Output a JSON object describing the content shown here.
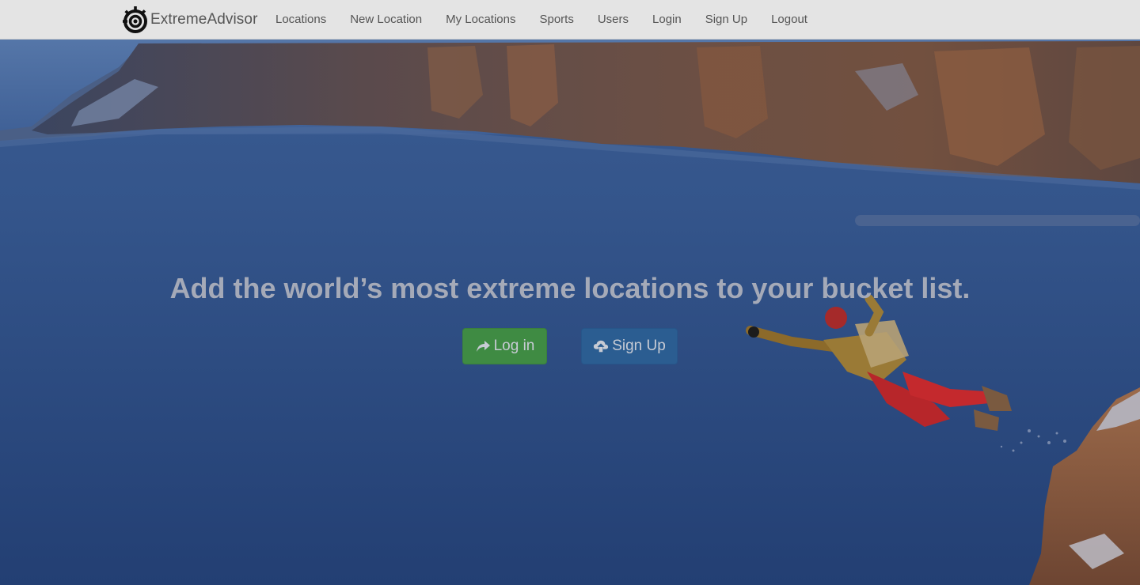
{
  "navbar": {
    "brand": "ExtremeAdvisor",
    "brand_icon": "steelseries-logo-icon",
    "items": [
      {
        "label": "Locations"
      },
      {
        "label": "New Location"
      },
      {
        "label": "My Locations"
      },
      {
        "label": "Sports"
      },
      {
        "label": "Users"
      },
      {
        "label": "Login"
      },
      {
        "label": "Sign Up"
      },
      {
        "label": "Logout"
      }
    ]
  },
  "hero": {
    "headline": "Add the world’s most extreme locations to your bucket list.",
    "login_button": {
      "label": "Log in",
      "icon": "share-arrow-icon",
      "color": "#3f8b43"
    },
    "signup_button": {
      "label": "Sign Up",
      "icon": "cloud-upload-icon",
      "color": "#2b5d91"
    }
  },
  "colors": {
    "navbar_bg": "#e4e4e4",
    "overlay_blue": "#284b80"
  }
}
